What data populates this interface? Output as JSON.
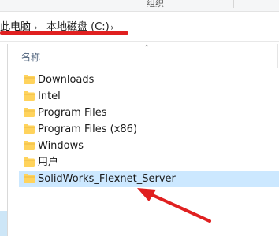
{
  "ribbon": {
    "group_label": "组织"
  },
  "address_bar": {
    "crumbs": [
      "此电脑",
      "本地磁盘 (C:)"
    ],
    "separator_icon": "chevron-right-icon"
  },
  "file_list": {
    "column_name": "名称",
    "sort_icon": "chevron-up-icon",
    "items": [
      {
        "name": "Downloads",
        "type": "folder",
        "selected": false
      },
      {
        "name": "Intel",
        "type": "folder",
        "selected": false
      },
      {
        "name": "Program Files",
        "type": "folder",
        "selected": false
      },
      {
        "name": "Program Files (x86)",
        "type": "folder",
        "selected": false
      },
      {
        "name": "Windows",
        "type": "folder",
        "selected": false
      },
      {
        "name": "用户",
        "type": "folder",
        "selected": false
      },
      {
        "name": "SolidWorks_Flexnet_Server",
        "type": "folder",
        "selected": true
      }
    ]
  },
  "annotation": {
    "color": "#e02020",
    "underline_target": "address-bar",
    "arrow_target": "SolidWorks_Flexnet_Server"
  },
  "colors": {
    "selection": "#cce8ff",
    "folder": "#ffd35c",
    "header_text": "#4c607a"
  }
}
